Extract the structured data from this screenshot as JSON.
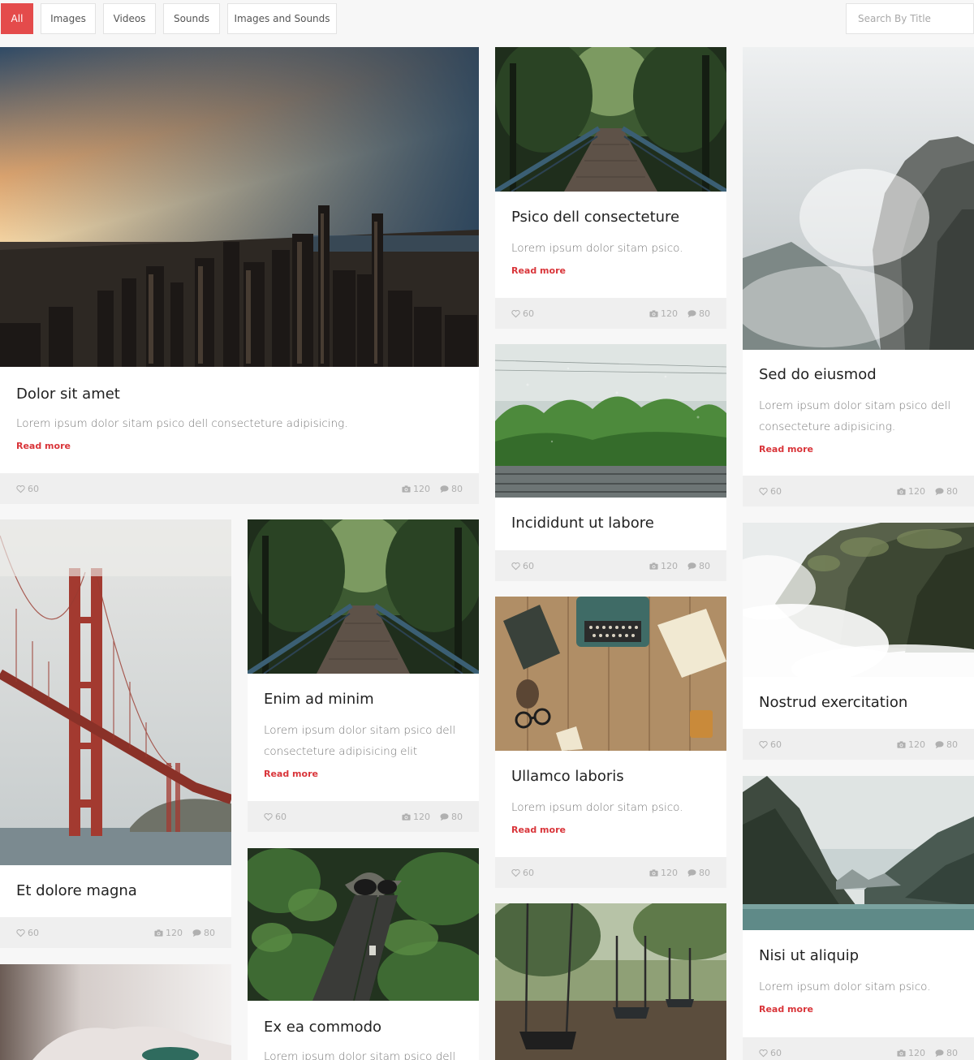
{
  "filters": {
    "all": "All",
    "images": "Images",
    "videos": "Videos",
    "sounds": "Sounds",
    "images_and_sounds": "Images and Sounds"
  },
  "search": {
    "placeholder": "Search By Title",
    "value": ""
  },
  "accent_color": "#e44b4b",
  "cards": [
    {
      "title": "Dolor sit amet",
      "desc": "Lorem ipsum dolor sitam psico dell consecteture adipisicing.",
      "read_more": "Read more",
      "likes": "60",
      "photos": "120",
      "comments": "80"
    },
    {
      "title": "Psico dell consecteture",
      "desc": "Lorem ipsum dolor sitam psico.",
      "read_more": "Read more",
      "likes": "60",
      "photos": "120",
      "comments": "80"
    },
    {
      "title": "Sed do eiusmod",
      "desc": "Lorem ipsum dolor sitam psico dell consecteture adipisicing.",
      "read_more": "Read more",
      "likes": "60",
      "photos": "120",
      "comments": "80"
    },
    {
      "title": "Incididunt ut labore",
      "likes": "60",
      "photos": "120",
      "comments": "80"
    },
    {
      "title": "Et dolore magna",
      "likes": "60",
      "photos": "120",
      "comments": "80"
    },
    {
      "title": "Enim ad minim",
      "desc": "Lorem ipsum dolor sitam psico dell consecteture adipisicing elit",
      "read_more": "Read more",
      "likes": "60",
      "photos": "120",
      "comments": "80"
    },
    {
      "title": "Nostrud exercitation",
      "likes": "60",
      "photos": "120",
      "comments": "80"
    },
    {
      "title": "Ullamco laboris",
      "desc": "Lorem ipsum dolor sitam psico.",
      "read_more": "Read more",
      "likes": "60",
      "photos": "120",
      "comments": "80"
    },
    {
      "title": "Nisi ut aliquip",
      "desc": "Lorem ipsum dolor sitam psico.",
      "read_more": "Read more",
      "likes": "60",
      "photos": "120",
      "comments": "80"
    },
    {
      "title": "Ex ea commodo",
      "desc": "Lorem ipsum dolor sitam psico dell"
    }
  ]
}
